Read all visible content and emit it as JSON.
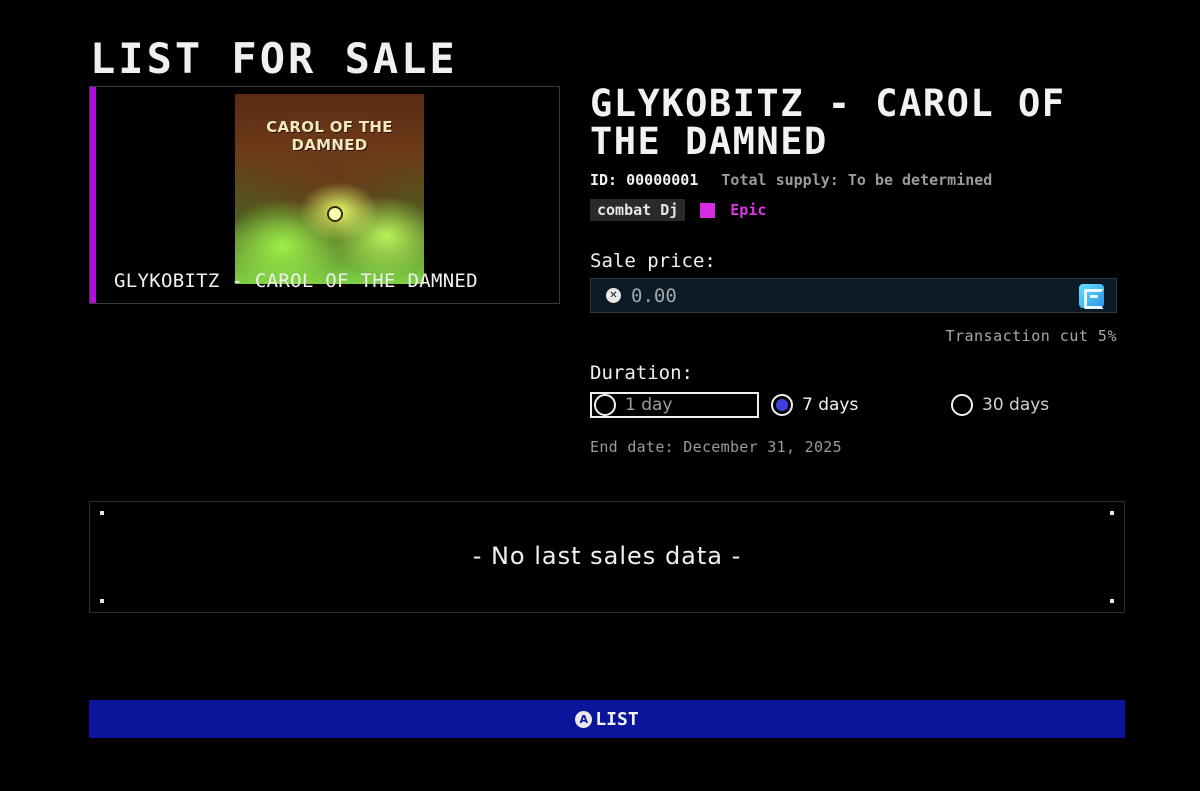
{
  "page": {
    "title": "LIST FOR SALE"
  },
  "item": {
    "card_caption": "GLYKOBITZ - CAROL OF THE DAMNED",
    "cover_title": "CAROL OF THE DAMNED",
    "title": "GLYKOBITZ - CAROL OF THE DAMNED",
    "id_label": "ID: 00000001",
    "total_supply": "Total supply: To be determined",
    "tag": "combat Dj",
    "rarity": "Epic",
    "rarity_color": "#d62be0"
  },
  "sale": {
    "label": "Sale price:",
    "button_glyph": "✕",
    "placeholder": "0.00",
    "currency_icon": "currency-coin-icon",
    "transaction_cut": "Transaction cut 5%"
  },
  "duration": {
    "label": "Duration:",
    "options": [
      {
        "label": "1 day",
        "selected": false
      },
      {
        "label": "7 days",
        "selected": true
      },
      {
        "label": "30 days",
        "selected": false
      }
    ],
    "end_date": "End date: December 31, 2025"
  },
  "last_sales": {
    "empty_text": "- No last sales data -"
  },
  "actions": {
    "list_glyph": "A",
    "list_label": "LIST",
    "list_color": "#0b149a"
  }
}
